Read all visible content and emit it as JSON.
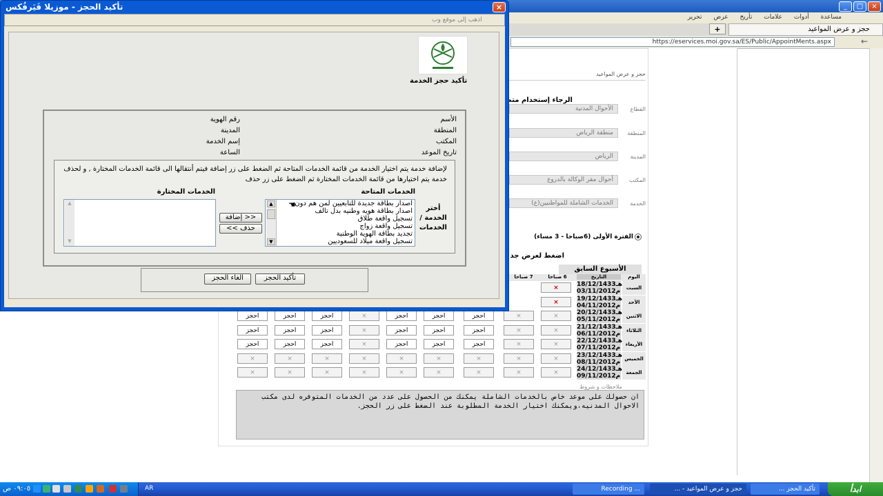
{
  "background_browser": {
    "tab_title": "حجز و عرض المواعيد",
    "new_tab_symbol": "+",
    "url": "https://eservices.moi.gov.sa/ES/Public/AppointMents.aspx",
    "menu_items": [
      "مساعدة",
      "أدوات",
      "علامات",
      "تأريخ",
      "عرض",
      "تحرير"
    ],
    "page": {
      "breadcrumb": "حجز و عرض المواعيد",
      "please_use": "الرجاء إستخدام متص",
      "fields": [
        {
          "label": "القطاع",
          "value": "الأحوال المدنية"
        },
        {
          "label": "المنطقة",
          "value": "منطقة الرياض"
        },
        {
          "label": "المدينة",
          "value": "الرياض"
        },
        {
          "label": "المكتب",
          "value": "أحوال مقر الوكالة بالدروع"
        },
        {
          "label": "الخدمة",
          "value": "الخدمات الشاملة للمواطنيين(ع)"
        }
      ],
      "period_label": "الفترة الأولى (6صباحا - 3 مساء)",
      "press_to_show": "اضغط لعرض جد",
      "prev_week": "الأسبوع السابق",
      "col_day": "اليوم",
      "col_date": "التاريخ",
      "col_6am": "6 صباحا",
      "col_7am": "7 صباحا",
      "book_label": "احجز",
      "x_mark": "×",
      "rows": [
        {
          "day": "السبت",
          "hijri": "18/12/1433هـ",
          "greg": "03/11/2012م"
        },
        {
          "day": "الأحد",
          "hijri": "19/12/1433هـ",
          "greg": "04/11/2012م"
        },
        {
          "day": "الاثنين",
          "hijri": "20/12/1433هـ",
          "greg": "05/11/2012م"
        },
        {
          "day": "الثلاثاء",
          "hijri": "21/12/1433هـ",
          "greg": "06/11/2012م"
        },
        {
          "day": "الأربعاء",
          "hijri": "22/12/1433هـ",
          "greg": "07/11/2012م"
        },
        {
          "day": "الخميس",
          "hijri": "23/12/1433هـ",
          "greg": "08/11/2012م"
        },
        {
          "day": "الجمعة",
          "hijri": "24/12/1433هـ",
          "greg": "09/11/2012م"
        }
      ],
      "notes_label": "ملاحظات و شروط",
      "notes_text": "ان حصولك على موعد خاص بالخدمات الشاملة يمكنك من الحصول على عدد من الخدمات المتوفره لدى مكتب الاحوال المدنيه،ويمكنك اختيار الخدمة المطلوبة عند الضغط على زر الحجز."
    }
  },
  "dialog": {
    "title": "تأكيد الحجز - موزيلا فَيَرفُكس",
    "close_symbol": "×",
    "address_text": "اذهب إلى موقع وب",
    "heading": "تأكيد حجز الخدمة",
    "info": {
      "name": "الأسم",
      "id_number": "رقم الهوية",
      "region": "المنطقة",
      "city": "المدينة",
      "office": "المكتب",
      "service_name": "إسم الخدمة",
      "appointment_date": "تاريخ الموعد",
      "time": "الساعة"
    },
    "instructions": "لإضافة خدمة يتم اختيار الخدمة من قائمة الخدمات المتاحة ثم الضغط على زر إضافة فيتم أنتقالها الى قائمة الخدمات المختارة , و لحذف خدمة يتم اختيارها من قائمة الخدمات المختارة ثم الضغط على زر حذف",
    "available_label": "الخدمات المتاحة",
    "selected_label": "الخدمات المختارة",
    "choose_services_label": "أختر الخدمة / الخدمات",
    "available_services": [
      "اصدار بطاقة جديدة للتابعيين لمن هم دون",
      "اصدار بطاقة هويه وطنيه بدل تالف",
      "تسجيل واقعة طلاق",
      "تسجيل واقعة زواج",
      "تجديد بطاقة الهوية الوطنية",
      "تسجيل واقعة ميلاد للسعوديين"
    ],
    "add_button": "إضافة >>",
    "remove_button": "<< حذف",
    "confirm_button": "تأكيد الحجز",
    "cancel_button": "الغاء الحجز"
  },
  "taskbar": {
    "clock": "٠٩:٠٥ ص",
    "lang": "AR",
    "tasks": [
      "Recording ...",
      "حجز و عرض المواعيد - ...",
      "تأكيد الحجز ..."
    ],
    "start_label": "ابدأ"
  },
  "colors": {
    "xp_blue": "#0a5ad4",
    "dialog_bg": "#ece9d8",
    "unavailable_red": "#cc0000"
  }
}
